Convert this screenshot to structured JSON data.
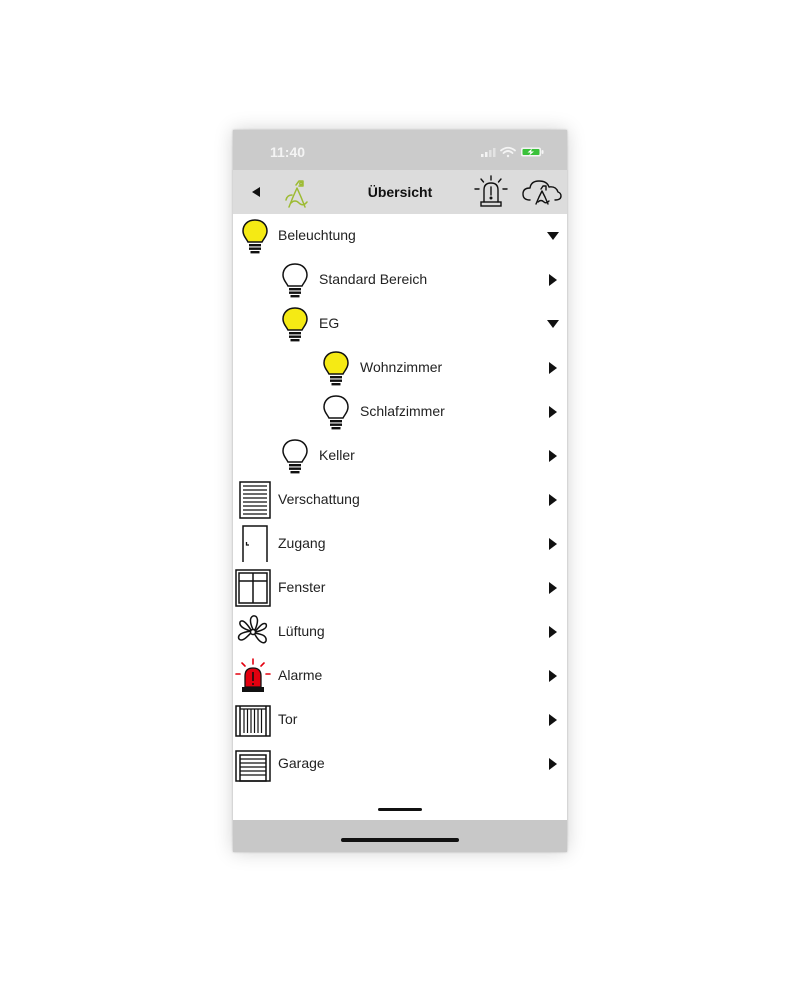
{
  "status": {
    "time": "11:40"
  },
  "header": {
    "title": "Übersicht"
  },
  "colors": {
    "bulb_on": "#f5ea14",
    "alarm_red": "#e3000f",
    "logo_green": "#9dbb33",
    "bar_gray": "#dcdcdc"
  },
  "tree": [
    {
      "label": "Beleuchtung",
      "icon": "lightbulb-on-icon",
      "expanded": true
    },
    {
      "label": "Standard Bereich",
      "icon": "lightbulb-off-icon",
      "expanded": false
    },
    {
      "label": "EG",
      "icon": "lightbulb-on-icon",
      "expanded": true
    },
    {
      "label": "Wohnzimmer",
      "icon": "lightbulb-on-icon",
      "expanded": false
    },
    {
      "label": "Schlafzimmer",
      "icon": "lightbulb-off-icon",
      "expanded": false
    },
    {
      "label": "Keller",
      "icon": "lightbulb-off-icon",
      "expanded": false
    },
    {
      "label": "Verschattung",
      "icon": "shutter-icon",
      "expanded": false
    },
    {
      "label": "Zugang",
      "icon": "door-icon",
      "expanded": false
    },
    {
      "label": "Fenster",
      "icon": "window-icon",
      "expanded": false
    },
    {
      "label": "Lüftung",
      "icon": "fan-icon",
      "expanded": false
    },
    {
      "label": "Alarme",
      "icon": "alarm-light-icon",
      "expanded": false
    },
    {
      "label": "Tor",
      "icon": "gate-icon",
      "expanded": false
    },
    {
      "label": "Garage",
      "icon": "garage-icon",
      "expanded": false
    }
  ]
}
